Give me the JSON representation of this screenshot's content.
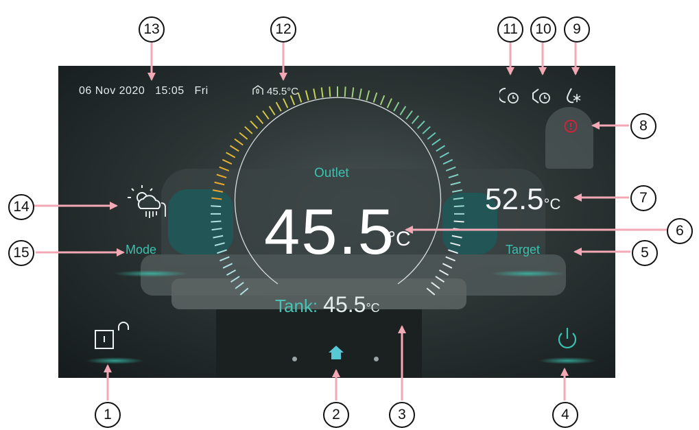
{
  "status_bar": {
    "date": "06 Nov 2020",
    "time": "15:05",
    "weekday": "Fri",
    "room_temp": "45.5°C"
  },
  "main": {
    "outlet_label": "Outlet",
    "outlet_value": "45.5",
    "outlet_unit": "°C",
    "tank_label": "Tank:",
    "tank_value": "45.5",
    "tank_unit": "°C",
    "target_value": "52.5",
    "target_unit": "°C",
    "target_label": "Target",
    "mode_label": "Mode"
  },
  "icons": {
    "status": [
      "timer-icon",
      "silent-timer-icon",
      "defrost-icon"
    ],
    "alarm": "alarm-icon",
    "mode": "weather-mode-icon",
    "lock": "unlock-icon",
    "home": "home-icon",
    "power": "power-icon",
    "room": "room-temperature-icon"
  },
  "colors": {
    "accent": "#3ac2b0",
    "alarm": "#e0203a",
    "callout_arrow": "#f3a9b5"
  },
  "callouts": [
    "1",
    "2",
    "3",
    "4",
    "5",
    "6",
    "7",
    "8",
    "9",
    "10",
    "11",
    "12",
    "13",
    "14",
    "15"
  ]
}
